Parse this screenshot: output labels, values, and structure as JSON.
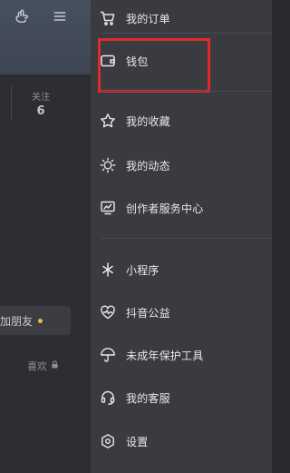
{
  "background": {
    "follow_label": "关注",
    "follow_count": "6",
    "add_friend_label": "加朋友",
    "likes_label": "喜欢",
    "icons": [
      "hand-pointer-icon",
      "menu-icon",
      "lock-icon"
    ]
  },
  "drawer": {
    "items": [
      {
        "label": "我的订单",
        "icon": "cart-icon"
      },
      {
        "label": "钱包",
        "icon": "wallet-icon"
      },
      {
        "label": "我的收藏",
        "icon": "star-icon"
      },
      {
        "label": "我的动态",
        "icon": "sun-icon"
      },
      {
        "label": "创作者服务中心",
        "icon": "monitor-chart-icon"
      },
      {
        "label": "小程序",
        "icon": "asterisk-icon"
      },
      {
        "label": "抖音公益",
        "icon": "heart-pulse-icon"
      },
      {
        "label": "未成年保护工具",
        "icon": "umbrella-icon"
      },
      {
        "label": "我的客服",
        "icon": "headset-icon"
      },
      {
        "label": "设置",
        "icon": "settings-hex-icon"
      }
    ]
  },
  "colors": {
    "drawer_bg": "#3a3b41",
    "text": "#e8e8ea",
    "highlight": "#e02a2a",
    "accent_dot": "#e6c244"
  }
}
